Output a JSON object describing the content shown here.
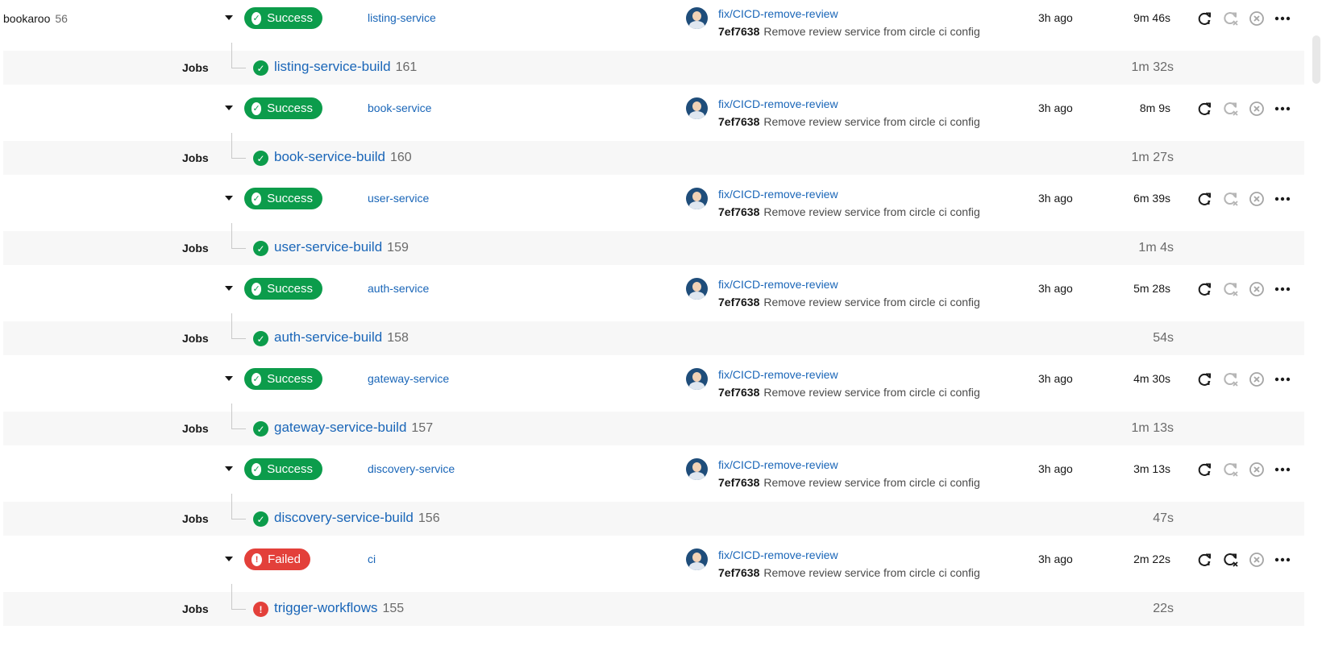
{
  "project": {
    "name": "bookaroo",
    "number": "56"
  },
  "commit_row": {
    "branch": "fix/CICD-remove-review",
    "sha": "7ef7638",
    "message": "Remove review service from circle ci config",
    "ago": "3h ago"
  },
  "jobs_label": "Jobs",
  "status_colors": {
    "success": "#0c9c4b",
    "failed": "#e3403a",
    "link": "#1a66b8"
  },
  "workflows": [
    {
      "status": "Success",
      "state": "success",
      "name": "listing-service",
      "duration": "9m 46s",
      "rerun_failed_enabled": false,
      "job": {
        "name": "listing-service-build",
        "number": "161",
        "duration": "1m 32s",
        "state": "success"
      }
    },
    {
      "status": "Success",
      "state": "success",
      "name": "book-service",
      "duration": "8m 9s",
      "rerun_failed_enabled": false,
      "job": {
        "name": "book-service-build",
        "number": "160",
        "duration": "1m 27s",
        "state": "success"
      }
    },
    {
      "status": "Success",
      "state": "success",
      "name": "user-service",
      "duration": "6m 39s",
      "rerun_failed_enabled": false,
      "job": {
        "name": "user-service-build",
        "number": "159",
        "duration": "1m 4s",
        "state": "success"
      }
    },
    {
      "status": "Success",
      "state": "success",
      "name": "auth-service",
      "duration": "5m 28s",
      "rerun_failed_enabled": false,
      "job": {
        "name": "auth-service-build",
        "number": "158",
        "duration": "54s",
        "state": "success"
      }
    },
    {
      "status": "Success",
      "state": "success",
      "name": "gateway-service",
      "duration": "4m 30s",
      "rerun_failed_enabled": false,
      "job": {
        "name": "gateway-service-build",
        "number": "157",
        "duration": "1m 13s",
        "state": "success"
      }
    },
    {
      "status": "Success",
      "state": "success",
      "name": "discovery-service",
      "duration": "3m 13s",
      "rerun_failed_enabled": false,
      "job": {
        "name": "discovery-service-build",
        "number": "156",
        "duration": "47s",
        "state": "success"
      }
    },
    {
      "status": "Failed",
      "state": "failed",
      "name": "ci",
      "duration": "2m 22s",
      "rerun_failed_enabled": true,
      "job": {
        "name": "trigger-workflows",
        "number": "155",
        "duration": "22s",
        "state": "failed"
      }
    }
  ]
}
